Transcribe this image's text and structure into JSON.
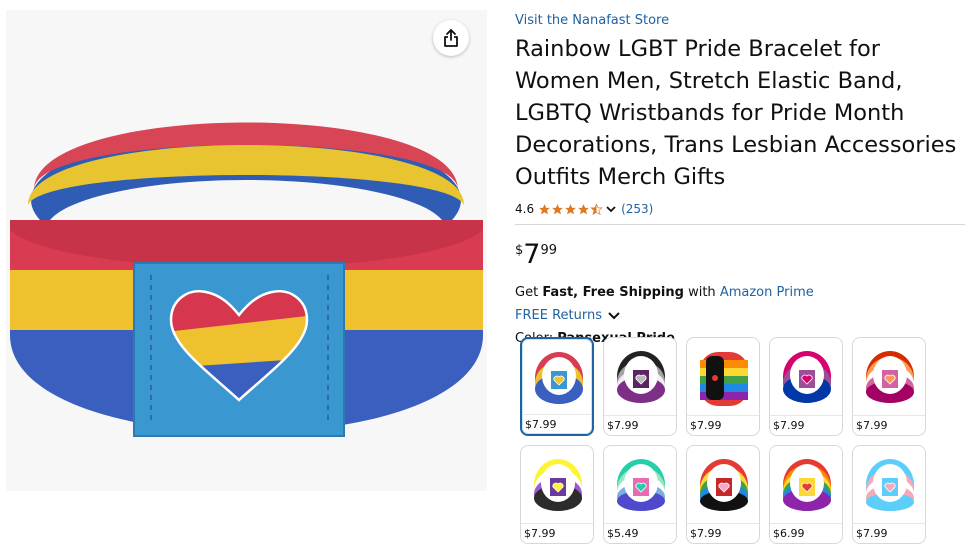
{
  "product": {
    "store_link": "Visit the Nanafast Store",
    "title": "Rainbow LGBT Pride Bracelet for Women Men, Stretch Elastic Band, LGBTQ Wristbands for Pride Month Decorations, Trans Lesbian Accessories Outfits Merch Gifts",
    "rating": "4.6",
    "rating_stars": 4.5,
    "reviews": "(253)",
    "price_symbol": "$",
    "price_whole": "7",
    "price_fraction": "99",
    "shipping_prefix": "Get",
    "shipping_bold": "Fast, Free Shipping",
    "shipping_with": "with",
    "shipping_link": "Amazon Prime",
    "returns": "FREE Returns",
    "color_label": "Color:",
    "color_value": "Pansexual Pride"
  },
  "colors": {
    "link": "#2162a1",
    "star": "#de7921",
    "selected_border": "#2162a1"
  },
  "icons": {
    "share": "share-icon",
    "star": "star-icon",
    "chevron": "chevron-down-icon"
  },
  "swatches": [
    {
      "price": "$7.99",
      "selected": true
    },
    {
      "price": "$7.99",
      "selected": false
    },
    {
      "price": "$7.99",
      "selected": false
    },
    {
      "price": "$7.99",
      "selected": false
    },
    {
      "price": "$7.99",
      "selected": false
    },
    {
      "price": "$7.99",
      "selected": false
    },
    {
      "price": "$5.49",
      "selected": false
    },
    {
      "price": "$7.99",
      "selected": false
    },
    {
      "price": "$6.99",
      "selected": false
    },
    {
      "price": "$7.99",
      "selected": false
    }
  ]
}
